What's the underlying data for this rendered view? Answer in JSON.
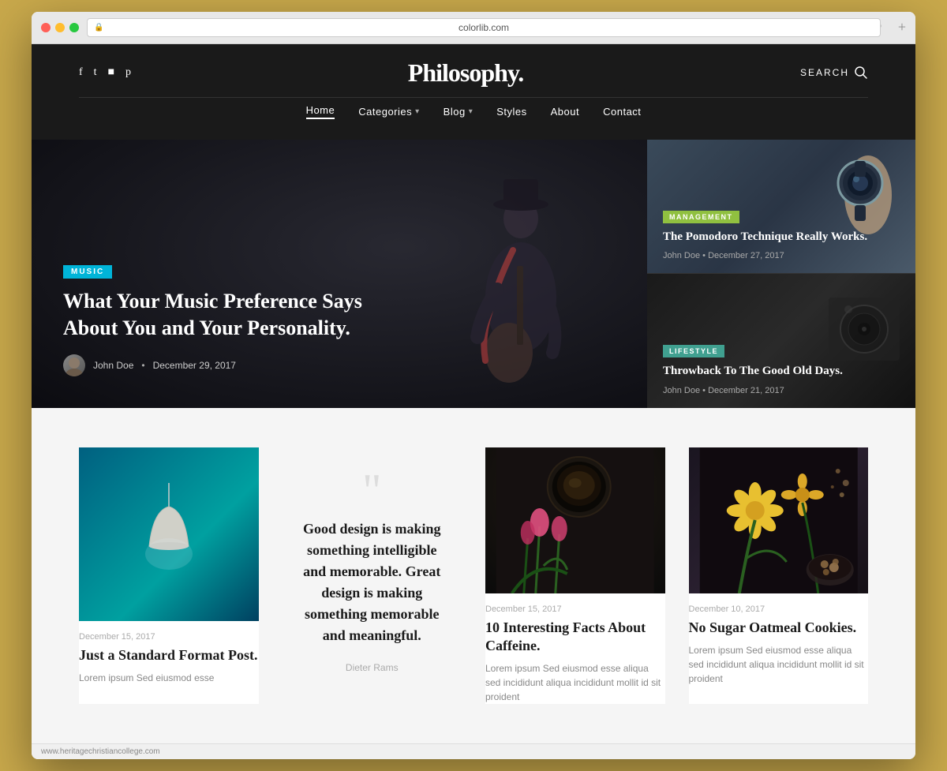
{
  "browser": {
    "url": "colorlib.com",
    "refresh_label": "↻",
    "plus_label": "+"
  },
  "header": {
    "title": "Philosophy.",
    "search_label": "SEARCH",
    "social": {
      "facebook": "f",
      "twitter": "t",
      "instagram": "i",
      "pinterest": "p"
    },
    "nav": [
      {
        "label": "Home",
        "active": true,
        "has_dropdown": false
      },
      {
        "label": "Categories",
        "active": false,
        "has_dropdown": true
      },
      {
        "label": "Blog",
        "active": false,
        "has_dropdown": true
      },
      {
        "label": "Styles",
        "active": false,
        "has_dropdown": false
      },
      {
        "label": "About",
        "active": false,
        "has_dropdown": false
      },
      {
        "label": "Contact",
        "active": false,
        "has_dropdown": false
      }
    ]
  },
  "hero": {
    "main": {
      "badge": "MUSIC",
      "title": "What Your Music Preference Says About You and Your Personality.",
      "author": "John Doe",
      "date": "December 29, 2017",
      "dot": "•"
    },
    "cards": [
      {
        "category": "MANAGEMENT",
        "badge_color": "badge-green",
        "title": "The Pomodoro Technique Really Works.",
        "author": "John Doe",
        "date": "December 27, 2017",
        "dot": "•"
      },
      {
        "category": "LIFESTYLE",
        "badge_color": "badge-teal",
        "title": "Throwback To The Good Old Days.",
        "author": "John Doe",
        "date": "December 21, 2017",
        "dot": "•"
      }
    ]
  },
  "posts": [
    {
      "type": "image",
      "date": "December 15, 2017",
      "title": "Just a Standard Format Post.",
      "excerpt": "Lorem ipsum Sed eiusmod esse"
    },
    {
      "type": "quote",
      "quote_text": "Good design is making something intelligible and memorable. Great design is making something memorable and meaningful.",
      "quote_author": "Dieter Rams"
    },
    {
      "type": "coffee",
      "date": "December 15, 2017",
      "title": "10 Interesting Facts About Caffeine.",
      "excerpt": "Lorem ipsum Sed eiusmod esse aliqua sed incididunt aliqua incididunt mollit id sit proident"
    },
    {
      "type": "food",
      "date": "December 10, 2017",
      "title": "No Sugar Oatmeal Cookies.",
      "excerpt": "Lorem ipsum Sed eiusmod esse aliqua sed incididunt aliqua incididunt mollit id sit proident"
    }
  ],
  "footer": {
    "url": "www.heritagechristiancollege.com"
  }
}
